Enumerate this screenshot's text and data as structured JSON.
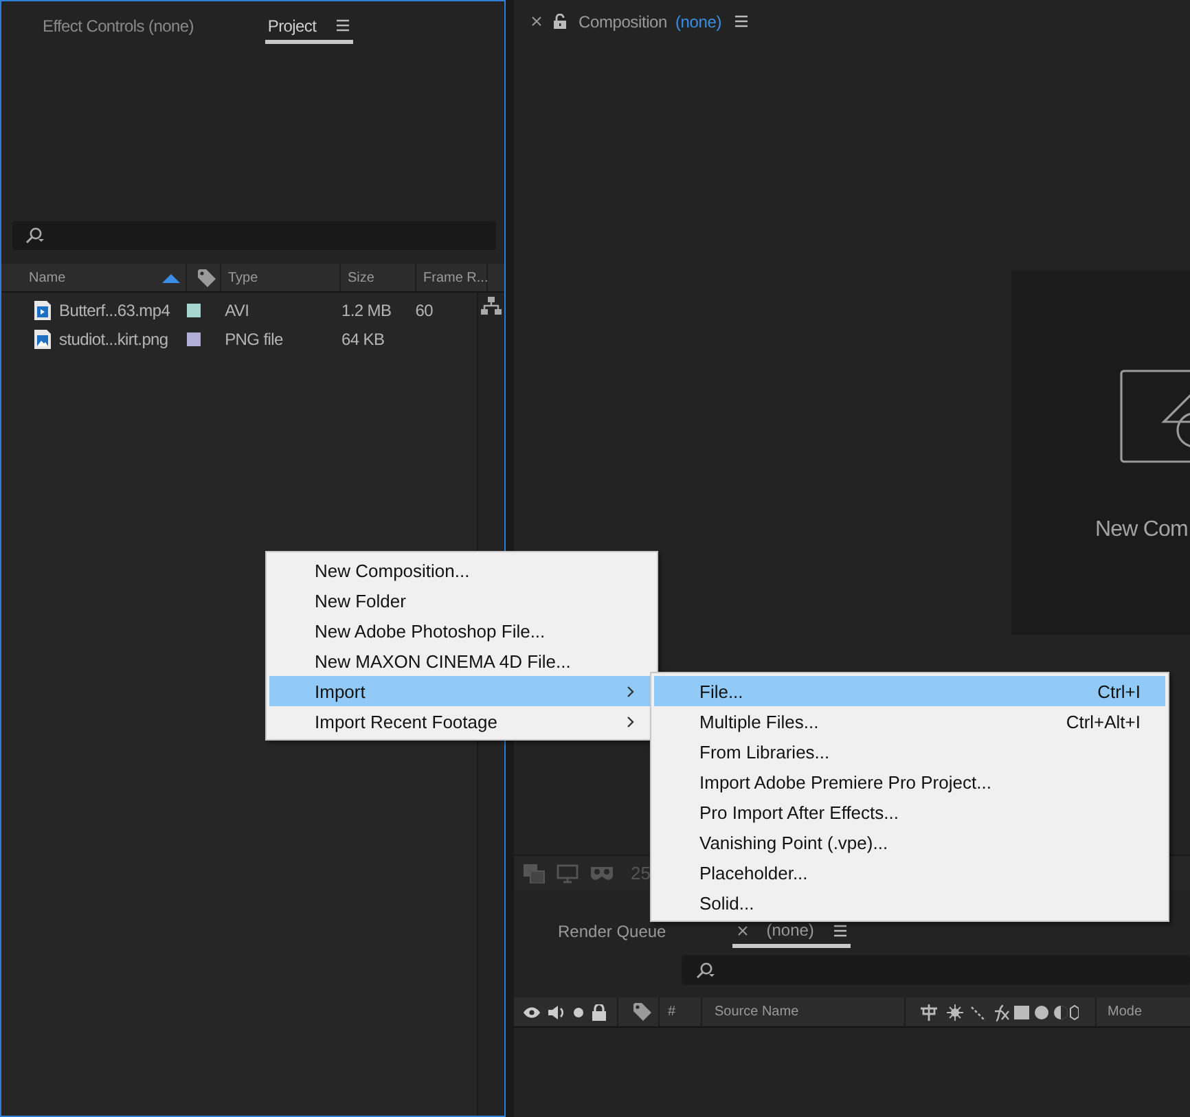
{
  "project_panel": {
    "tabs": [
      {
        "label": "Effect Controls (none)",
        "selected": false
      },
      {
        "label": "Project",
        "selected": true
      }
    ],
    "columns": [
      "Name",
      "Type",
      "Size",
      "Frame R..."
    ],
    "rows": [
      {
        "kind": "video",
        "name": "Butterf...63.mp4",
        "color": "#a6d6cf",
        "type": "AVI",
        "size": "1.2 MB",
        "frame_rate": "60"
      },
      {
        "kind": "image",
        "name": "studiot...kirt.png",
        "color": "#b3aed6",
        "type": "PNG file",
        "size": "64 KB"
      }
    ]
  },
  "composition_panel": {
    "title": "Composition",
    "comp_name": "(none)",
    "new_comp_label": "New Com"
  },
  "viewer_toolbar": {
    "zoom": "25"
  },
  "timeline_panel": {
    "tabs": [
      {
        "label": "Render Queue",
        "selected": false,
        "closable": false
      },
      {
        "label": "(none)",
        "selected": true,
        "closable": true
      }
    ],
    "columns": [
      "#",
      "Source Name",
      "Mode"
    ]
  },
  "context_menu": {
    "items": [
      {
        "label": "New Composition...",
        "submenu": false,
        "selected": false
      },
      {
        "label": "New Folder",
        "submenu": false,
        "selected": false
      },
      {
        "label": "New Adobe Photoshop File...",
        "submenu": false,
        "selected": false
      },
      {
        "label": "New MAXON CINEMA 4D File...",
        "submenu": false,
        "selected": false
      },
      {
        "label": "Import",
        "submenu": true,
        "selected": true
      },
      {
        "label": "Import Recent Footage",
        "submenu": true,
        "selected": false
      }
    ]
  },
  "submenu": {
    "items": [
      {
        "label": "File...",
        "shortcut": "Ctrl+I",
        "selected": true
      },
      {
        "label": "Multiple Files...",
        "shortcut": "Ctrl+Alt+I",
        "selected": false
      },
      {
        "label": "From Libraries...",
        "selected": false
      },
      {
        "label": "Import Adobe Premiere Pro Project...",
        "selected": false
      },
      {
        "label": "Pro Import After Effects...",
        "selected": false
      },
      {
        "label": "Vanishing Point (.vpe)...",
        "selected": false
      },
      {
        "label": "Placeholder...",
        "selected": false
      },
      {
        "label": "Solid...",
        "selected": false
      }
    ]
  }
}
